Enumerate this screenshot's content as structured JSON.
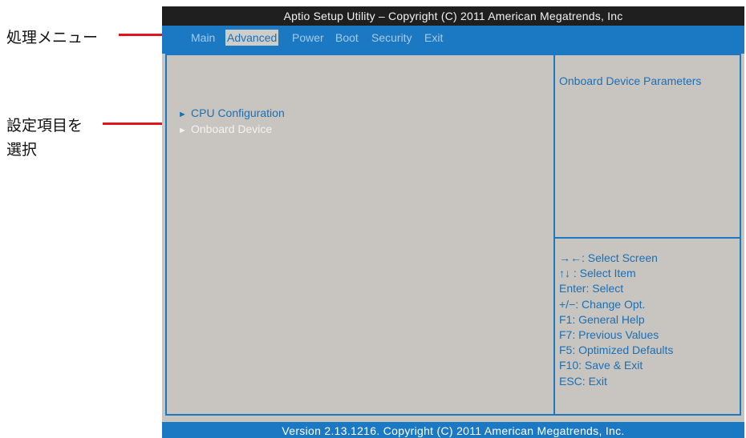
{
  "annotations": {
    "menu_label": "処理メニュー",
    "select_label_line1": "設定項目を",
    "select_label_line2": "選択"
  },
  "bios": {
    "title": "Aptio Setup Utility – Copyright (C) 2011 American Megatrends, Inc",
    "menu": [
      {
        "label": "Main",
        "active": false
      },
      {
        "label": "Advanced",
        "active": true
      },
      {
        "label": "Power",
        "active": false
      },
      {
        "label": "Boot",
        "active": false
      },
      {
        "label": "Security",
        "active": false
      },
      {
        "label": "Exit",
        "active": false
      }
    ],
    "entries": [
      {
        "arrow": "►",
        "label": "CPU Configuration",
        "selected": false
      },
      {
        "arrow": "►",
        "label": "Onboard Device",
        "selected": true
      }
    ],
    "help_title": "Onboard Device Parameters",
    "key_help": [
      "→←: Select Screen",
      "↑↓ : Select Item",
      "Enter: Select",
      "+/−: Change Opt.",
      "F1: General Help",
      "F7: Previous Values",
      "F5: Optimized Defaults",
      "F10: Save & Exit",
      "ESC: Exit"
    ],
    "footer": "Version 2.13.1216. Copyright (C) 2011 American Megatrends, Inc."
  },
  "colors": {
    "accent_blue": "#1b78c2",
    "panel_gray": "#c8c5c1",
    "title_bar": "#1f1f1f",
    "annotation_line": "#e0141e"
  }
}
